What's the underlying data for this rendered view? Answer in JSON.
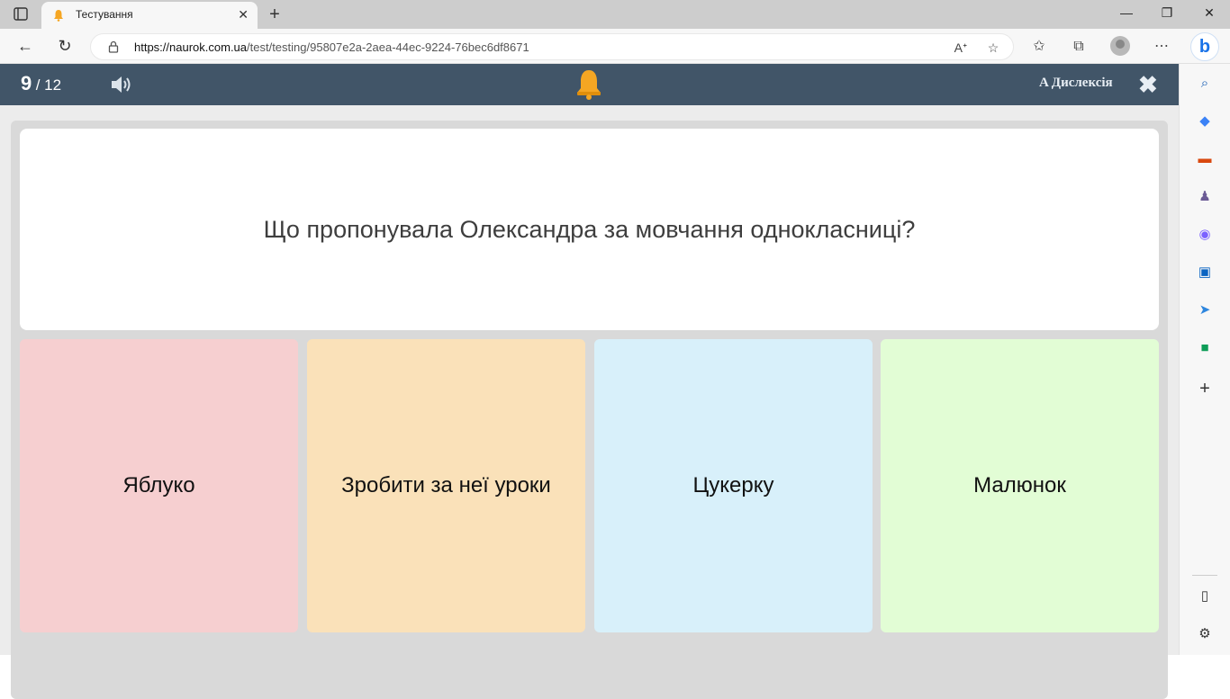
{
  "browser": {
    "tab_title": "Тестування",
    "url_host": "https://naurok.com.ua",
    "url_path": "/test/testing/95807e2a-2aea-44ec-9224-76bec6df8671"
  },
  "quiz": {
    "current": "9",
    "total": "/ 12",
    "dyslexia_label": "A Дислексія",
    "question": "Що пропонувала Олександра за мовчання однокласниці?",
    "answers": [
      {
        "label": "Яблуко",
        "color": "#f6cfd0"
      },
      {
        "label": "Зробити за неї уроки",
        "color": "#fae1b9"
      },
      {
        "label": "Цукерку",
        "color": "#d8f0fa"
      },
      {
        "label": "Малюнок",
        "color": "#e2fdd5"
      }
    ],
    "topbar_color": "#415568"
  }
}
